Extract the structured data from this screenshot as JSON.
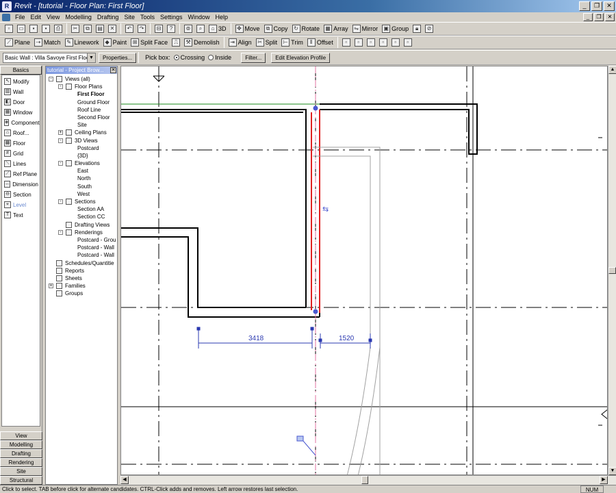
{
  "window": {
    "title": "Revit - [tutorial - Floor Plan: First Floor]",
    "app_icon": "revit-app-icon"
  },
  "menu": [
    "File",
    "Edit",
    "View",
    "Modelling",
    "Drafting",
    "Site",
    "Tools",
    "Settings",
    "Window",
    "Help"
  ],
  "toolbar1": {
    "view_tools": {
      "label": "3D"
    },
    "edit_tools": [
      "Move",
      "Copy",
      "Rotate",
      "Array",
      "Mirror",
      "Group"
    ]
  },
  "toolbar2": [
    "Plane",
    "Match",
    "Linework",
    "Paint",
    "Split Face",
    "Demolish",
    "Align",
    "Split",
    "Trim",
    "Offset"
  ],
  "options_bar": {
    "type_selector": "Basic Wall : Villa Savoye First Floor",
    "properties_button": "Properties...",
    "pick_box_label": "Pick box:",
    "crossing_label": "Crossing",
    "inside_label": "Inside",
    "selected_pick": "Crossing",
    "filter_button": "Filter...",
    "edit_profile_button": "Edit Elevation Profile"
  },
  "design_bar": {
    "top_tab": "Basics",
    "items": [
      {
        "label": "Modify",
        "icon": "arrow-cursor-icon"
      },
      {
        "label": "Wall",
        "icon": "wall-icon"
      },
      {
        "label": "Door",
        "icon": "door-icon"
      },
      {
        "label": "Window",
        "icon": "window-icon"
      },
      {
        "label": "Component",
        "icon": "component-icon"
      },
      {
        "label": "Roof...",
        "icon": "roof-icon"
      },
      {
        "label": "Floor",
        "icon": "floor-icon"
      },
      {
        "label": "Grid",
        "icon": "grid-icon"
      },
      {
        "label": "Lines",
        "icon": "lines-icon"
      },
      {
        "label": "Ref Plane",
        "icon": "ref-plane-icon"
      },
      {
        "label": "Dimension",
        "icon": "dimension-icon"
      },
      {
        "label": "Section",
        "icon": "section-icon"
      },
      {
        "label": "Level",
        "icon": "level-icon"
      },
      {
        "label": "Text",
        "icon": "text-icon"
      }
    ],
    "bottom_tabs": [
      "View",
      "Modelling",
      "Drafting",
      "Rendering",
      "Site",
      "Structural"
    ]
  },
  "project_browser": {
    "title": "tutorial - Project Brow...",
    "tree": [
      {
        "label": "Views (all)",
        "level": 0,
        "expander": "-",
        "icon": "eye-icon"
      },
      {
        "label": "Floor Plans",
        "level": 1,
        "expander": "-",
        "icon": "floor-plan-icon"
      },
      {
        "label": "First Floor",
        "level": 2,
        "bold": true
      },
      {
        "label": "Ground Floor",
        "level": 2
      },
      {
        "label": "Roof Line",
        "level": 2
      },
      {
        "label": "Second Floor",
        "level": 2
      },
      {
        "label": "Site",
        "level": 2
      },
      {
        "label": "Ceiling Plans",
        "level": 1,
        "expander": "+",
        "icon": "ceiling-plan-icon"
      },
      {
        "label": "3D Views",
        "level": 1,
        "expander": "-",
        "icon": "3d-view-icon"
      },
      {
        "label": "Postcard",
        "level": 2
      },
      {
        "label": "{3D}",
        "level": 2
      },
      {
        "label": "Elevations",
        "level": 1,
        "expander": "-",
        "icon": "elevation-icon"
      },
      {
        "label": "East",
        "level": 2
      },
      {
        "label": "North",
        "level": 2
      },
      {
        "label": "South",
        "level": 2
      },
      {
        "label": "West",
        "level": 2
      },
      {
        "label": "Sections",
        "level": 1,
        "expander": "-",
        "icon": "section-view-icon"
      },
      {
        "label": "Section AA",
        "level": 2
      },
      {
        "label": "Section CC",
        "level": 2
      },
      {
        "label": "Drafting Views",
        "level": 1,
        "icon": "drafting-view-icon"
      },
      {
        "label": "Renderings",
        "level": 1,
        "expander": "-",
        "icon": "rendering-icon"
      },
      {
        "label": "Postcard - Grou",
        "level": 2
      },
      {
        "label": "Postcard - Wall",
        "level": 2
      },
      {
        "label": "Postcard - Wall",
        "level": 2
      },
      {
        "label": "Schedules/Quantitie",
        "level": 0,
        "icon": "schedule-icon"
      },
      {
        "label": "Reports",
        "level": 0,
        "icon": "report-icon"
      },
      {
        "label": "Sheets",
        "level": 0,
        "icon": "sheet-icon"
      },
      {
        "label": "Families",
        "level": 0,
        "expander": "+",
        "icon": "family-icon"
      },
      {
        "label": "Groups",
        "level": 0,
        "icon": "group-icon"
      }
    ]
  },
  "drawing": {
    "dimensions": [
      "3418",
      "1520"
    ],
    "selection_color": "#e02020",
    "grip_color": "#4a58d0",
    "dimension_color": "#2a38b0",
    "level_line_color": "#1a8a1a"
  },
  "status": {
    "message": "Click to select. TAB before click for alternate candidates. CTRL-Click adds and removes. Left arrow restores last selection.",
    "num": "NUM"
  }
}
